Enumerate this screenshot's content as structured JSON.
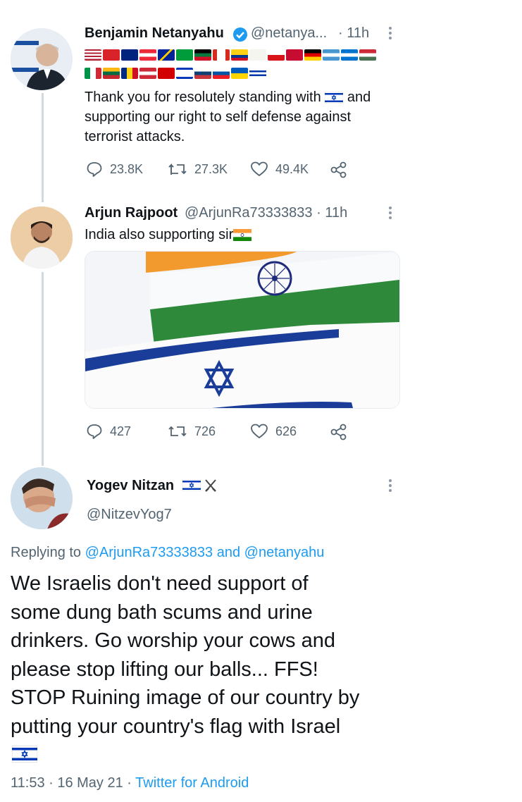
{
  "tweet1": {
    "name": "Benjamin Netanyahu",
    "handle": "@netanya...",
    "time": "· 11h",
    "text_l1": "Thank you for resolutely standing with",
    "text_l1b": "and",
    "text_l2": "supporting our right to self defense against",
    "text_l3": "terrorist attacks.",
    "replies": "23.8K",
    "retweets": "27.3K",
    "likes": "49.4K"
  },
  "tweet2": {
    "name": "Arjun Rajpoot",
    "handle": "@ArjunRa73333833 · 11h",
    "text": "India also supporting sir",
    "replies": "427",
    "retweets": "726",
    "likes": "626"
  },
  "tweet3": {
    "name": "Yogev Nitzan",
    "handle": "@NitzevYog7",
    "replying_label": "Replying to",
    "reply_user1": "@ArjunRa73333833",
    "reply_and": "and",
    "reply_user2": "@netanyahu",
    "lines": [
      "We Israelis don't need support of",
      "some dung bath scums and urine",
      "drinkers. Go worship your cows and",
      "please stop lifting our balls... FFS!",
      "STOP Ruining image of our country by",
      "putting your country's flag with Israel"
    ],
    "time": "11:53 · 16 May 21 ·",
    "client": "Twitter for Android"
  },
  "colors": {
    "accent": "#1d9bf0",
    "muted": "#536471",
    "text": "#0f1419"
  },
  "icons": [
    "verified-icon",
    "reply-icon",
    "retweet-icon",
    "like-icon",
    "share-icon",
    "more-icon",
    "israel-flag",
    "india-flag",
    "crossed-swords-icon"
  ]
}
